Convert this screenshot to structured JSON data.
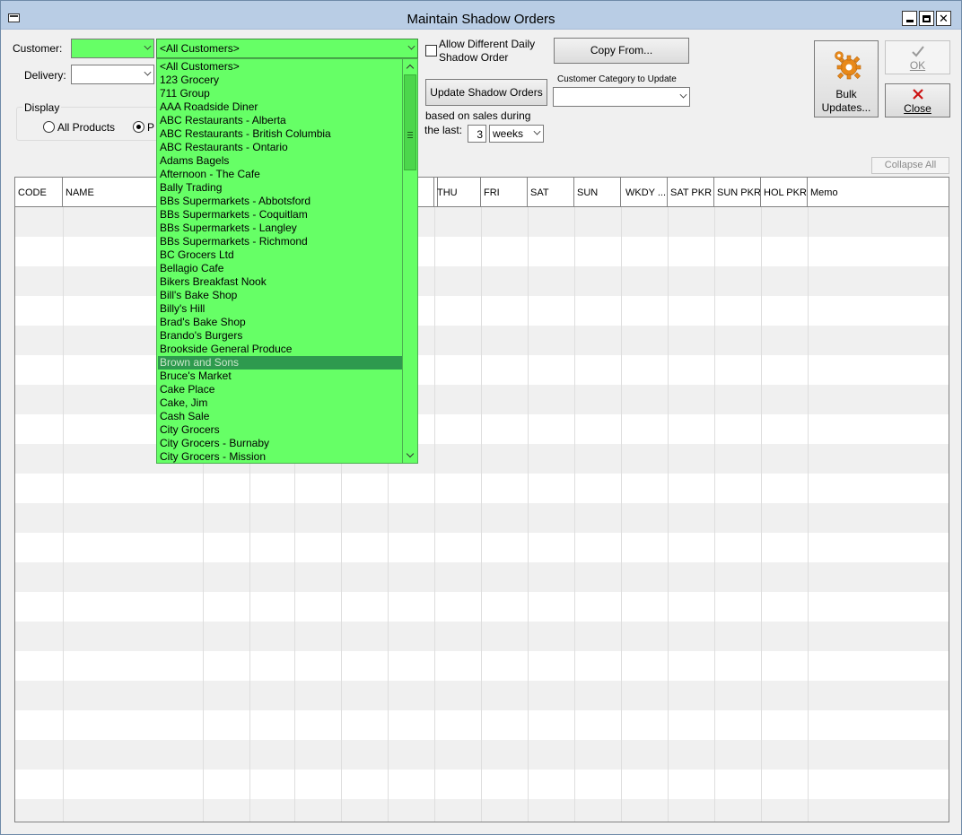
{
  "window": {
    "title": "Maintain Shadow Orders"
  },
  "form": {
    "customer_label": "Customer:",
    "delivery_label": "Delivery:",
    "customer_code_value": "",
    "customer_name_value": "<All Customers>",
    "delivery_value": "",
    "display_label": "Display",
    "display_options": [
      "All Products",
      "P"
    ],
    "allow_diff_label_1": "Allow Different Daily",
    "allow_diff_label_2": "Shadow Order",
    "copy_from_label": "Copy From...",
    "update_shadow_label": "Update Shadow Orders",
    "category_label": "Customer Category to Update",
    "category_value": "",
    "based_on_label_1": "based on sales during",
    "based_on_label_2": "the last:",
    "weeks_count": "3",
    "weeks_unit": "weeks",
    "bulk_label_1": "Bulk",
    "bulk_label_2": "Updates...",
    "ok_label": "OK",
    "close_label": "Close",
    "collapse_all_label": "Collapse All"
  },
  "grid": {
    "columns": [
      "CODE",
      "NAME",
      "",
      "",
      "",
      "",
      "",
      "",
      "THU",
      "FRI",
      "SAT",
      "SUN",
      "WKDY ...",
      "SAT PKR",
      "SUN PKR",
      "HOL PKR",
      "Memo"
    ]
  },
  "dropdown": {
    "selected": "Brown and Sons",
    "items": [
      "<All Customers>",
      "123 Grocery",
      "711 Group",
      "AAA Roadside Diner",
      "ABC Restaurants - Alberta",
      "ABC Restaurants - British Columbia",
      "ABC Restaurants - Ontario",
      "Adams Bagels",
      "Afternoon - The Cafe",
      "Bally Trading",
      "BBs Supermarkets - Abbotsford",
      "BBs Supermarkets - Coquitlam",
      "BBs Supermarkets - Langley",
      "BBs Supermarkets - Richmond",
      "BC Grocers Ltd",
      "Bellagio Cafe",
      "Bikers Breakfast Nook",
      "Bill's Bake Shop",
      "Billy's Hill",
      "Brad's Bake Shop",
      "Brando's Burgers",
      "Brookside General Produce",
      "Brown and Sons",
      "Bruce's Market",
      "Cake Place",
      "Cake, Jim",
      "Cash Sale",
      "City Grocers",
      "City Grocers - Burnaby",
      "City Grocers - Mission"
    ]
  },
  "colors": {
    "highlight_green": "#66ff66",
    "selected_item": "#2e9a4e",
    "close_x": "#cc1111",
    "gear_orange": "#e8891a"
  }
}
